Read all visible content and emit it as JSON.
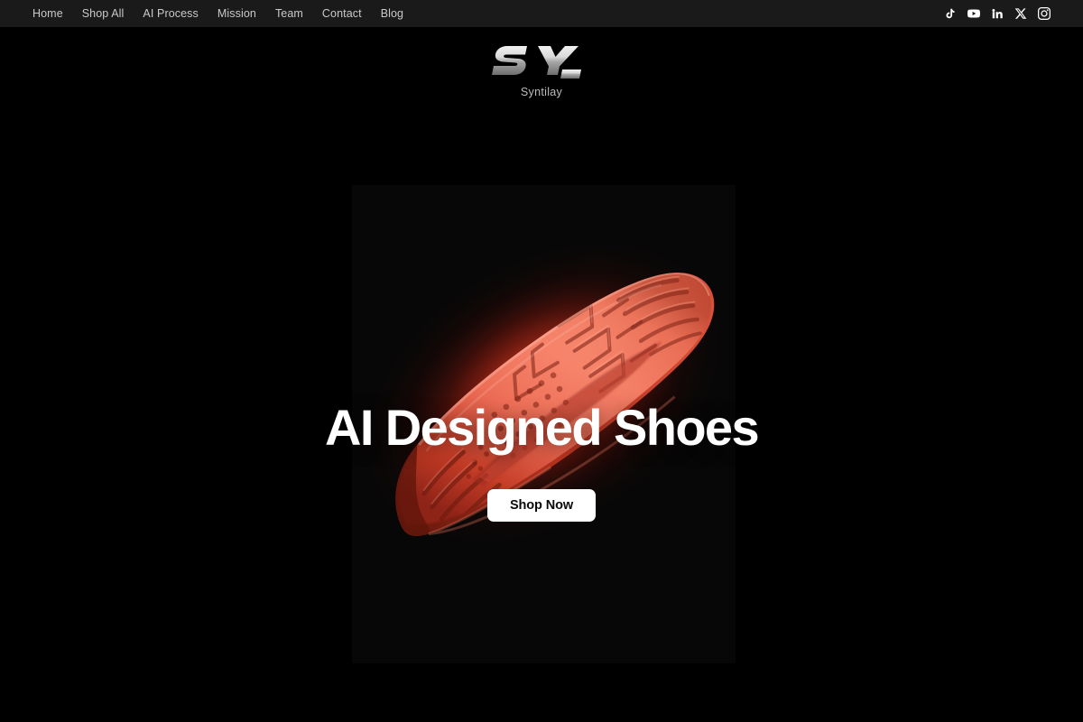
{
  "site": {
    "brand_name": "Syntilay",
    "logo_glyph": "SY",
    "background_color": "#000000",
    "accent_color": "#e8503a",
    "topbar_color": "#1a1a1a"
  },
  "topbar": {
    "nav": [
      {
        "label": "Home",
        "name": "nav-home"
      },
      {
        "label": "Shop All",
        "name": "nav-shop-all"
      },
      {
        "label": "AI Process",
        "name": "nav-ai-process"
      },
      {
        "label": "Mission",
        "name": "nav-mission"
      },
      {
        "label": "Team",
        "name": "nav-team"
      },
      {
        "label": "Contact",
        "name": "nav-contact"
      },
      {
        "label": "Blog",
        "name": "nav-blog"
      }
    ],
    "socials": [
      {
        "icon": "tiktok-icon",
        "label": "TikTok"
      },
      {
        "icon": "youtube-icon",
        "label": "YouTube"
      },
      {
        "icon": "linkedin-icon",
        "label": "LinkedIn"
      },
      {
        "icon": "x-twitter-icon",
        "label": "X"
      },
      {
        "icon": "instagram-icon",
        "label": "Instagram"
      }
    ]
  },
  "hero": {
    "headline": "AI Designed Shoes",
    "cta_label": "Shop Now",
    "product_image_alt": "red 3d printed sneaker",
    "product_color": "#e8604a",
    "glow_color": "#ff3c1e"
  }
}
